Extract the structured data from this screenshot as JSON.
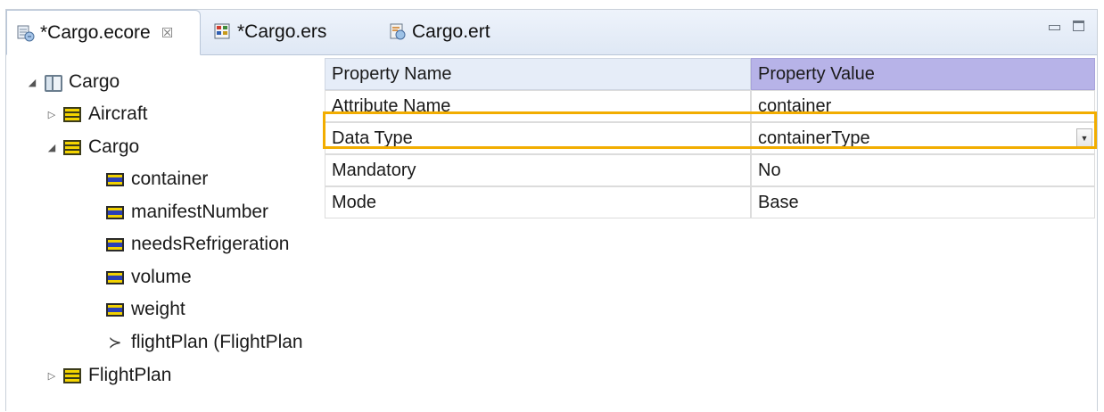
{
  "tabs": [
    {
      "label": "*Cargo.ecore",
      "close": "☒",
      "icon": "ecore-model-icon"
    },
    {
      "label": "*Cargo.ers",
      "icon": "ers-file-icon"
    },
    {
      "label": "Cargo.ert",
      "icon": "ert-file-icon"
    }
  ],
  "tree": {
    "root": {
      "label": "Cargo",
      "expanded": true
    },
    "items": [
      {
        "label": "Aircraft",
        "kind": "class",
        "expanded": false
      },
      {
        "label": "Cargo",
        "kind": "class",
        "expanded": true
      },
      {
        "label": "container",
        "kind": "attribute"
      },
      {
        "label": "manifestNumber",
        "kind": "attribute"
      },
      {
        "label": "needsRefrigeration",
        "kind": "attribute"
      },
      {
        "label": "volume",
        "kind": "attribute"
      },
      {
        "label": "weight",
        "kind": "attribute"
      },
      {
        "label": "flightPlan (FlightPlan",
        "kind": "reference"
      },
      {
        "label": "FlightPlan",
        "kind": "class",
        "expanded": false
      }
    ]
  },
  "properties": {
    "headers": {
      "name": "Property Name",
      "value": "Property Value"
    },
    "rows": [
      {
        "name": "Attribute Name",
        "value": "container"
      },
      {
        "name": "Data Type",
        "value": "containerType"
      },
      {
        "name": "Mandatory",
        "value": "No"
      },
      {
        "name": "Mode",
        "value": "Base"
      }
    ]
  },
  "colors": {
    "highlight": "#f2ad00",
    "value_header": "#b7b3e8"
  }
}
